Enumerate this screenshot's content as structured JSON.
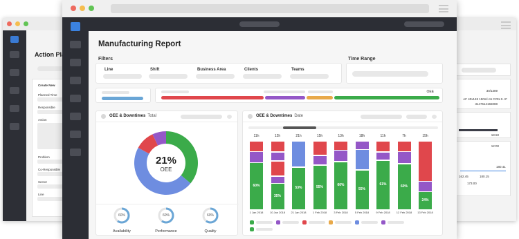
{
  "colors": {
    "green": "#3bab4a",
    "red": "#e0474c",
    "blue": "#6e8de0",
    "purple": "#9457c7",
    "orange": "#e8a94a",
    "light_blue": "#6aa6d6",
    "sidebar": "#2c2e35",
    "dot_red": "#ee6a5e",
    "dot_yellow": "#f5bd4f",
    "dot_green": "#61c454"
  },
  "main": {
    "title": "Manufacturing Report",
    "filters_label": "Filters",
    "time_range_label": "Time Range",
    "filters": [
      "Line",
      "Shift",
      "Business Area",
      "Clients",
      "Teams"
    ],
    "oee_bar_label": "OEE"
  },
  "oee_card": {
    "title": "OEE & Downtimes",
    "subtitle": "Total",
    "percent": "21%",
    "label": "OEE",
    "gauges": [
      {
        "label": "Availability",
        "value": "60%"
      },
      {
        "label": "Performance",
        "value": "60%"
      },
      {
        "label": "Quality",
        "value": "60%"
      }
    ]
  },
  "chart_card": {
    "title": "OEE & Downtimes",
    "subtitle": "Date"
  },
  "chart_data": {
    "type": "bar",
    "stacked": true,
    "categories": [
      "1 Jan 2018",
      "10 Jan 2018",
      "21 Jan 2018",
      "1 Feb 2018",
      "3 Feb 2018",
      "5 Feb 2018",
      "9 Feb 2018",
      "12 Feb 2018",
      "13 Feb 2018"
    ],
    "top_labels": [
      "11h",
      "12h",
      "21h",
      "15h",
      "13h",
      "18h",
      "11h",
      "7h",
      "15h"
    ],
    "value_labels": [
      "60%",
      "35%",
      "53%",
      "55%",
      "60%",
      "55%",
      "61%",
      "60%",
      "24%"
    ],
    "series": [
      {
        "color": "green",
        "values": [
          60,
          35,
          53,
          55,
          60,
          55,
          61,
          60,
          24
        ]
      },
      {
        "color": "purple",
        "values": [
          14,
          10,
          0,
          12,
          14,
          0,
          10,
          16,
          14
        ]
      },
      {
        "color": "blue",
        "values": [
          0,
          0,
          33,
          0,
          0,
          28,
          0,
          0,
          0
        ]
      },
      {
        "color": "red",
        "values": [
          14,
          20,
          0,
          18,
          12,
          0,
          14,
          14,
          54
        ]
      },
      {
        "color": "purple",
        "values": [
          0,
          12,
          0,
          0,
          0,
          12,
          0,
          0,
          0
        ]
      },
      {
        "color": "blue",
        "values": [
          0,
          0,
          0,
          0,
          0,
          0,
          0,
          0,
          0
        ]
      }
    ],
    "top_series": [
      {
        "color": "red",
        "values": [
          0,
          15,
          0,
          0,
          0,
          0,
          0,
          0,
          0
        ]
      }
    ],
    "legend_colors": [
      "green",
      "purple",
      "red",
      "orange",
      "blue",
      "purple",
      "green"
    ]
  },
  "left_window": {
    "title": "Action Pla",
    "fields": [
      "Create New",
      "Planned Time",
      "Responsible",
      "Action",
      "Problem",
      "Co-Responsible",
      "Sector",
      "Line"
    ]
  },
  "right_window": {
    "values": [
      "30/1389",
      "AF 40x148 150ml A5 CON.S. IF",
      "3147514155088",
      "18.50",
      "12:00",
      "162.45",
      "180.15",
      "173.00",
      "180.41"
    ]
  }
}
